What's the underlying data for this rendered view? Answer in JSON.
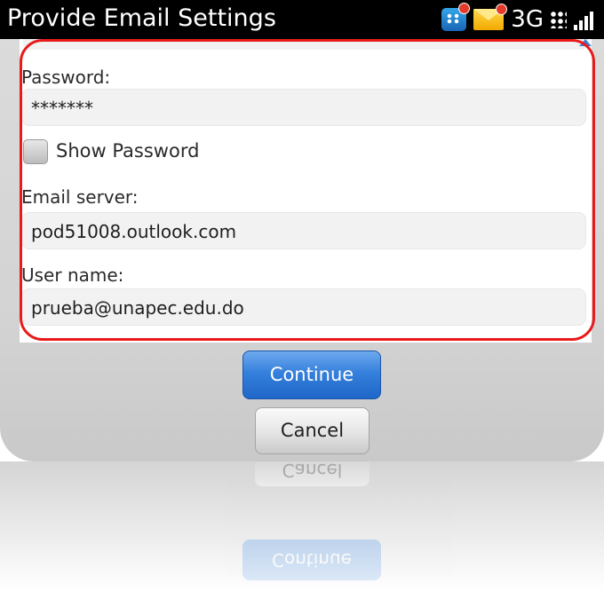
{
  "statusbar": {
    "title": "Provide Email Settings",
    "network": "3G",
    "icons": [
      "bbm-icon",
      "mail-icon",
      "blackberry-logo-icon",
      "signal-strength-icon"
    ]
  },
  "form": {
    "password_label": "Password:",
    "password_value": "*******",
    "show_password_label": "Show Password",
    "show_password_checked": false,
    "email_server_label": "Email server:",
    "email_server_value": "pod51008.outlook.com",
    "username_label": "User name:",
    "username_value": "prueba@unapec.edu.do"
  },
  "actions": {
    "continue_label": "Continue",
    "cancel_label": "Cancel"
  },
  "colors": {
    "highlight": "#e81a1a",
    "primary_button": "#2f78d8",
    "statusbar": "#000000"
  }
}
